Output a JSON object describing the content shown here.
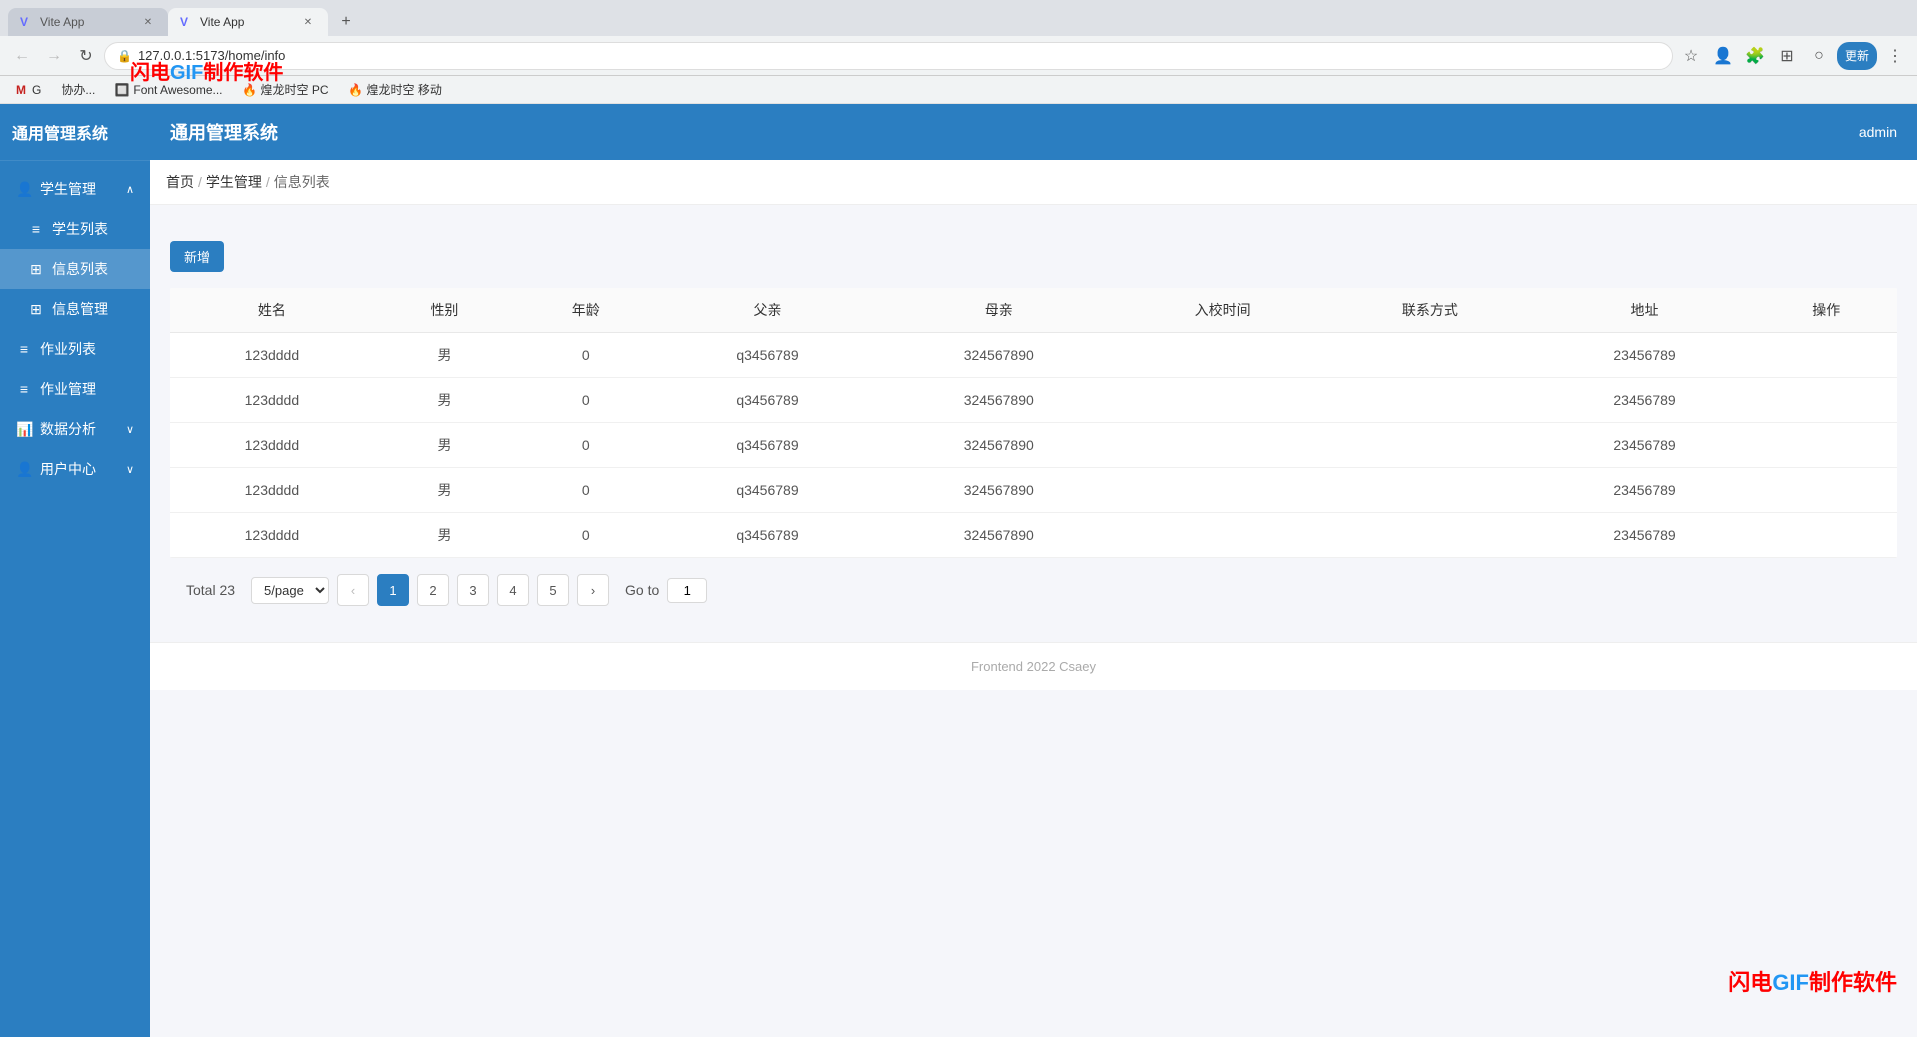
{
  "browser": {
    "tabs": [
      {
        "id": "tab1",
        "title": "Vite App",
        "favicon": "V",
        "active": false
      },
      {
        "id": "tab2",
        "title": "Vite App",
        "favicon": "V",
        "active": true
      }
    ],
    "address": "127.0.0.1:5173/home/info",
    "bookmarks": [
      {
        "label": "G",
        "text": "协办..."
      },
      {
        "label": "★",
        "text": "Font Awesome..."
      },
      {
        "label": "🔥",
        "text": "煌龙时空 PC"
      },
      {
        "label": "🔥",
        "text": "煌龙时空 移动"
      }
    ]
  },
  "app": {
    "title": "通用管理系统",
    "header_user": "admin",
    "sidebar": {
      "groups": [
        {
          "label": "学生管理",
          "icon": "👤",
          "expanded": true,
          "items": [
            {
              "label": "学生列表",
              "icon": "≡",
              "active": false,
              "path": "student-list"
            },
            {
              "label": "信息列表",
              "icon": "⊞",
              "active": true,
              "path": "info-list"
            },
            {
              "label": "信息管理",
              "icon": "⊞",
              "active": false,
              "path": "info-manage"
            }
          ]
        },
        {
          "label": "作业列表",
          "icon": "≡",
          "expanded": false,
          "items": []
        },
        {
          "label": "作业管理",
          "icon": "≡",
          "expanded": false,
          "items": []
        },
        {
          "label": "数据分析",
          "icon": "📊",
          "expanded": false,
          "items": []
        },
        {
          "label": "用户中心",
          "icon": "👤",
          "expanded": false,
          "items": []
        }
      ]
    },
    "breadcrumb": {
      "items": [
        "首页",
        "学生管理",
        "信息列表"
      ]
    },
    "new_button_label": "新增",
    "table": {
      "columns": [
        "姓名",
        "性别",
        "年龄",
        "父亲",
        "母亲",
        "入校时间",
        "联系方式",
        "地址",
        "操作"
      ],
      "rows": [
        {
          "name": "123dddd",
          "gender": "男",
          "age": "0",
          "father": "q3456789",
          "mother": "324567890",
          "enroll": "",
          "contact": "",
          "address": "23456789",
          "action": ""
        },
        {
          "name": "123dddd",
          "gender": "男",
          "age": "0",
          "father": "q3456789",
          "mother": "324567890",
          "enroll": "",
          "contact": "",
          "address": "23456789",
          "action": ""
        },
        {
          "name": "123dddd",
          "gender": "男",
          "age": "0",
          "father": "q3456789",
          "mother": "324567890",
          "enroll": "",
          "contact": "",
          "address": "23456789",
          "action": ""
        },
        {
          "name": "123dddd",
          "gender": "男",
          "age": "0",
          "father": "q3456789",
          "mother": "324567890",
          "enroll": "",
          "contact": "",
          "address": "23456789",
          "action": ""
        },
        {
          "name": "123dddd",
          "gender": "男",
          "age": "0",
          "father": "q3456789",
          "mother": "324567890",
          "enroll": "",
          "contact": "",
          "address": "23456789",
          "action": ""
        }
      ]
    },
    "pagination": {
      "total_label": "Total 23",
      "page_size": "5/page",
      "pages": [
        "1",
        "2",
        "3",
        "4",
        "5"
      ],
      "active_page": "1",
      "goto_label": "Go to",
      "goto_value": "1"
    },
    "footer": "Frontend 2022 Csaey"
  },
  "watermarks": {
    "tl": "闪电GIF制作软件",
    "br": "闪电GIF制作软件"
  }
}
